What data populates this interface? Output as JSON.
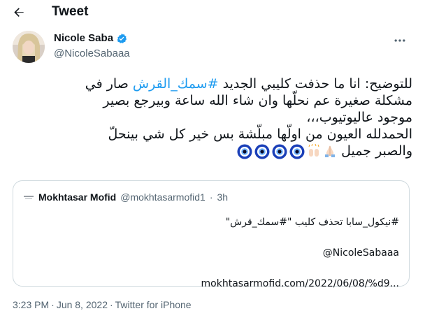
{
  "header": {
    "title": "Tweet"
  },
  "author": {
    "display_name": "Nicole Saba",
    "handle": "@NicoleSabaaa"
  },
  "tweet": {
    "line1_text": "للتوضيح: انا ما حذفت كليبي الجديد ",
    "line1_hashtag": "#سمك_القرش",
    "line1_end": " صار في",
    "line2": "مشكلة صغيرة عم نحلّها وان شاء الله ساعة وبيرجع بصير",
    "line3": "موجود عاليوتيوب،،،",
    "line4": "الحمدلله العيون من اولّها مبلّشة بس خير كل شي بينحلّ",
    "line5": "والصبر جميل"
  },
  "quote": {
    "name": "Mokhtasar Mofid",
    "handle": "@mokhtasarmofid1",
    "separator": "·",
    "time": "3h",
    "line1": "#نيكول_سابا تحذف كليب \"#سمك_قرش\"",
    "line2": "@NicoleSabaaa",
    "line3": "mokhtasarmofid.com/2022/06/08/%d9..."
  },
  "footer": {
    "time": "3:23 PM",
    "separator1": "·",
    "date": "Jun 8, 2022",
    "separator2": "·",
    "source": "Twitter for iPhone"
  },
  "colors": {
    "accent": "#1d9bf0",
    "secondary_text": "#536471",
    "border": "#cfd9de"
  }
}
